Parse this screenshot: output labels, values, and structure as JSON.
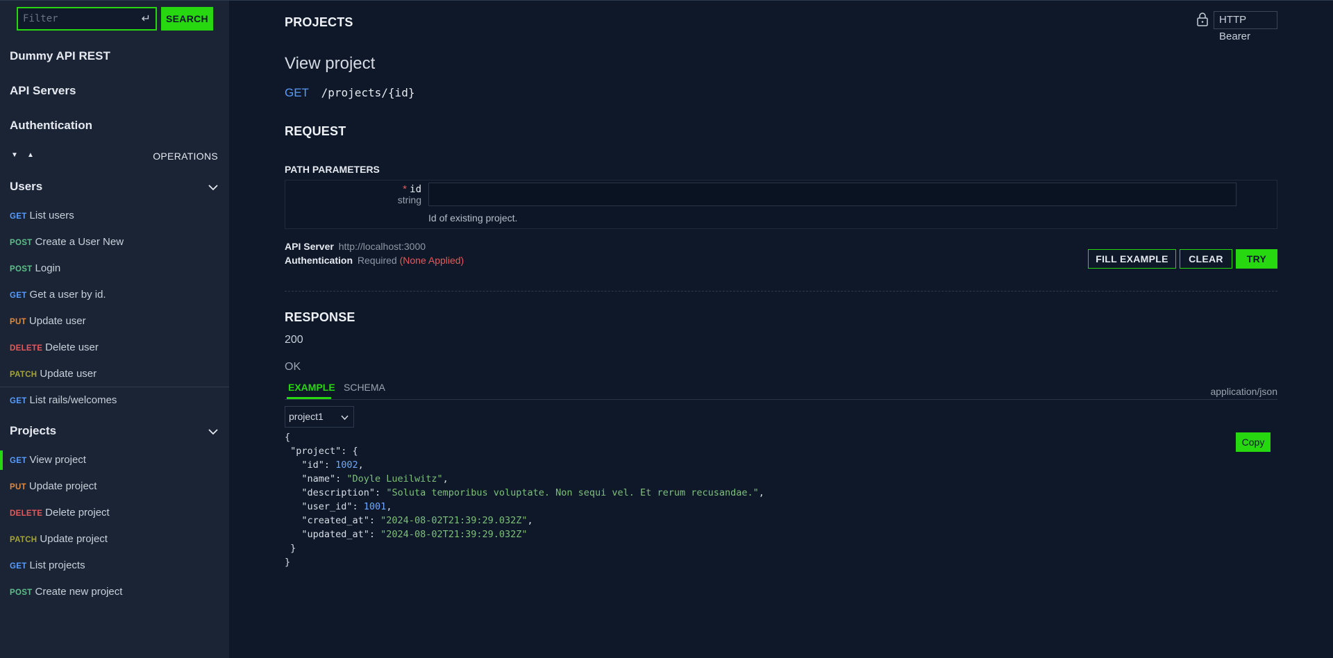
{
  "sidebar": {
    "filter_placeholder": "Filter",
    "search_label": "SEARCH",
    "headings": [
      "Dummy API REST",
      "API Servers",
      "Authentication"
    ],
    "operations_label": "OPERATIONS",
    "groups": [
      {
        "name": "Users",
        "items": [
          {
            "method": "GET",
            "label": "List users"
          },
          {
            "method": "POST",
            "label": "Create a User New"
          },
          {
            "method": "POST",
            "label": "Login"
          },
          {
            "method": "GET",
            "label": "Get a user by id."
          },
          {
            "method": "PUT",
            "label": "Update user"
          },
          {
            "method": "DELETE",
            "label": "Delete user"
          },
          {
            "method": "PATCH",
            "label": "Update user"
          }
        ]
      },
      {
        "name": "",
        "items": [
          {
            "method": "GET",
            "label": "List rails/welcomes"
          }
        ]
      },
      {
        "name": "Projects",
        "items": [
          {
            "method": "GET",
            "label": "View project",
            "active": true
          },
          {
            "method": "PUT",
            "label": "Update project"
          },
          {
            "method": "DELETE",
            "label": "Delete project"
          },
          {
            "method": "PATCH",
            "label": "Update project"
          },
          {
            "method": "GET",
            "label": "List projects"
          },
          {
            "method": "POST",
            "label": "Create new project"
          }
        ]
      }
    ]
  },
  "main": {
    "section": "PROJECTS",
    "auth_badge": "HTTP Bearer",
    "title": "View project",
    "method": "GET",
    "path": "/projects/{id}",
    "request_label": "REQUEST",
    "path_params_label": "PATH PARAMETERS",
    "param": {
      "required_mark": "*",
      "name": "id",
      "type": "string",
      "description": "Id of existing project.",
      "value": ""
    },
    "api_server_label": "API Server",
    "api_server_value": "http://localhost:3000",
    "auth_label": "Authentication",
    "auth_required": "Required",
    "auth_status": "(None Applied)",
    "buttons": {
      "fill": "FILL EXAMPLE",
      "clear": "CLEAR",
      "try": "TRY"
    },
    "response_label": "RESPONSE",
    "status_code": "200",
    "status_text": "OK",
    "tabs": {
      "example": "EXAMPLE",
      "schema": "SCHEMA"
    },
    "content_type": "application/json",
    "example_select": "project1",
    "copy_label": "Copy",
    "example_lines": [
      "{",
      " \"project\": {",
      "   \"id\": 1002,",
      "   \"name\": \"Doyle Lueilwitz\",",
      "   \"description\": \"Soluta temporibus voluptate. Non sequi vel. Et rerum recusandae.\",",
      "   \"user_id\": 1001,",
      "   \"created_at\": \"2024-08-02T21:39:29.032Z\",",
      "   \"updated_at\": \"2024-08-02T21:39:29.032Z\"",
      " }",
      "}"
    ]
  },
  "colors": {
    "accent": "#27d811",
    "get": "#5b9bf8",
    "post": "#5fbf8a",
    "put": "#e08a3c",
    "delete": "#e45a5a",
    "patch": "#a6a33a"
  },
  "icons": [
    "enter-icon",
    "lock-icon",
    "chevron-down-icon",
    "triangle-down-icon",
    "triangle-up-icon"
  ]
}
